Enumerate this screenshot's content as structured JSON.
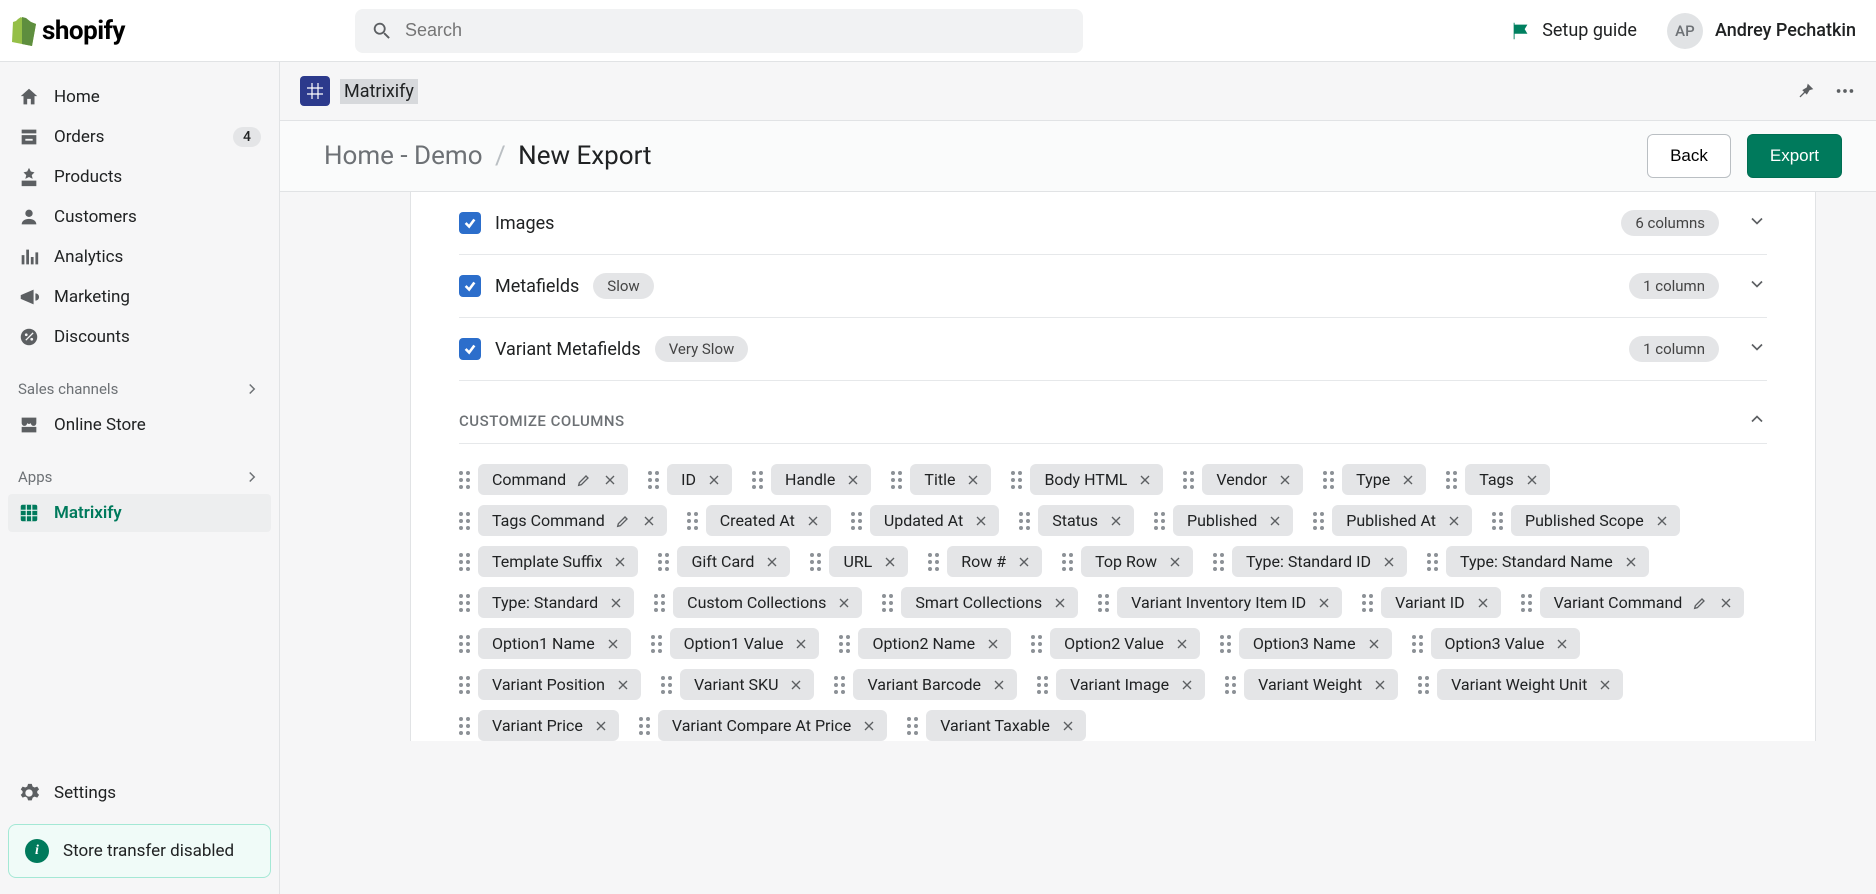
{
  "topbar": {
    "brand": "shopify",
    "search_placeholder": "Search",
    "setup_guide": "Setup guide",
    "user_initials": "AP",
    "user_name": "Andrey Pechatkin"
  },
  "sidebar": {
    "items": [
      {
        "label": "Home",
        "icon": "home"
      },
      {
        "label": "Orders",
        "icon": "orders",
        "badge": "4"
      },
      {
        "label": "Products",
        "icon": "products"
      },
      {
        "label": "Customers",
        "icon": "customers"
      },
      {
        "label": "Analytics",
        "icon": "analytics"
      },
      {
        "label": "Marketing",
        "icon": "marketing"
      },
      {
        "label": "Discounts",
        "icon": "discounts"
      }
    ],
    "sections": [
      {
        "label": "Sales channels"
      },
      {
        "label": "Apps"
      }
    ],
    "sales_channel_item": "Online Store",
    "app_item": "Matrixify",
    "settings": "Settings",
    "transfer_notice": "Store transfer disabled"
  },
  "appbar": {
    "app_name": "Matrixify"
  },
  "page_header": {
    "crumb1": "Home - Demo",
    "current": "New Export",
    "back": "Back",
    "export": "Export"
  },
  "checklist": [
    {
      "label": "Images",
      "badge": null,
      "count": "6 columns"
    },
    {
      "label": "Metafields",
      "badge": "Slow",
      "count": "1 column"
    },
    {
      "label": "Variant Metafields",
      "badge": "Very Slow",
      "count": "1 column"
    }
  ],
  "customize_section": "CUSTOMIZE COLUMNS",
  "columns": [
    {
      "label": "Command",
      "edit": true
    },
    {
      "label": "ID"
    },
    {
      "label": "Handle"
    },
    {
      "label": "Title"
    },
    {
      "label": "Body HTML"
    },
    {
      "label": "Vendor"
    },
    {
      "label": "Type"
    },
    {
      "label": "Tags"
    },
    {
      "label": "Tags Command",
      "edit": true
    },
    {
      "label": "Created At"
    },
    {
      "label": "Updated At"
    },
    {
      "label": "Status"
    },
    {
      "label": "Published"
    },
    {
      "label": "Published At"
    },
    {
      "label": "Published Scope"
    },
    {
      "label": "Template Suffix"
    },
    {
      "label": "Gift Card"
    },
    {
      "label": "URL"
    },
    {
      "label": "Row #"
    },
    {
      "label": "Top Row"
    },
    {
      "label": "Type: Standard ID"
    },
    {
      "label": "Type: Standard Name"
    },
    {
      "label": "Type: Standard"
    },
    {
      "label": "Custom Collections"
    },
    {
      "label": "Smart Collections"
    },
    {
      "label": "Variant Inventory Item ID"
    },
    {
      "label": "Variant ID"
    },
    {
      "label": "Variant Command",
      "edit": true
    },
    {
      "label": "Option1 Name"
    },
    {
      "label": "Option1 Value"
    },
    {
      "label": "Option2 Name"
    },
    {
      "label": "Option2 Value"
    },
    {
      "label": "Option3 Name"
    },
    {
      "label": "Option3 Value"
    },
    {
      "label": "Variant Position"
    },
    {
      "label": "Variant SKU"
    },
    {
      "label": "Variant Barcode"
    },
    {
      "label": "Variant Image"
    },
    {
      "label": "Variant Weight"
    },
    {
      "label": "Variant Weight Unit"
    },
    {
      "label": "Variant Price"
    },
    {
      "label": "Variant Compare At Price"
    },
    {
      "label": "Variant Taxable"
    }
  ]
}
